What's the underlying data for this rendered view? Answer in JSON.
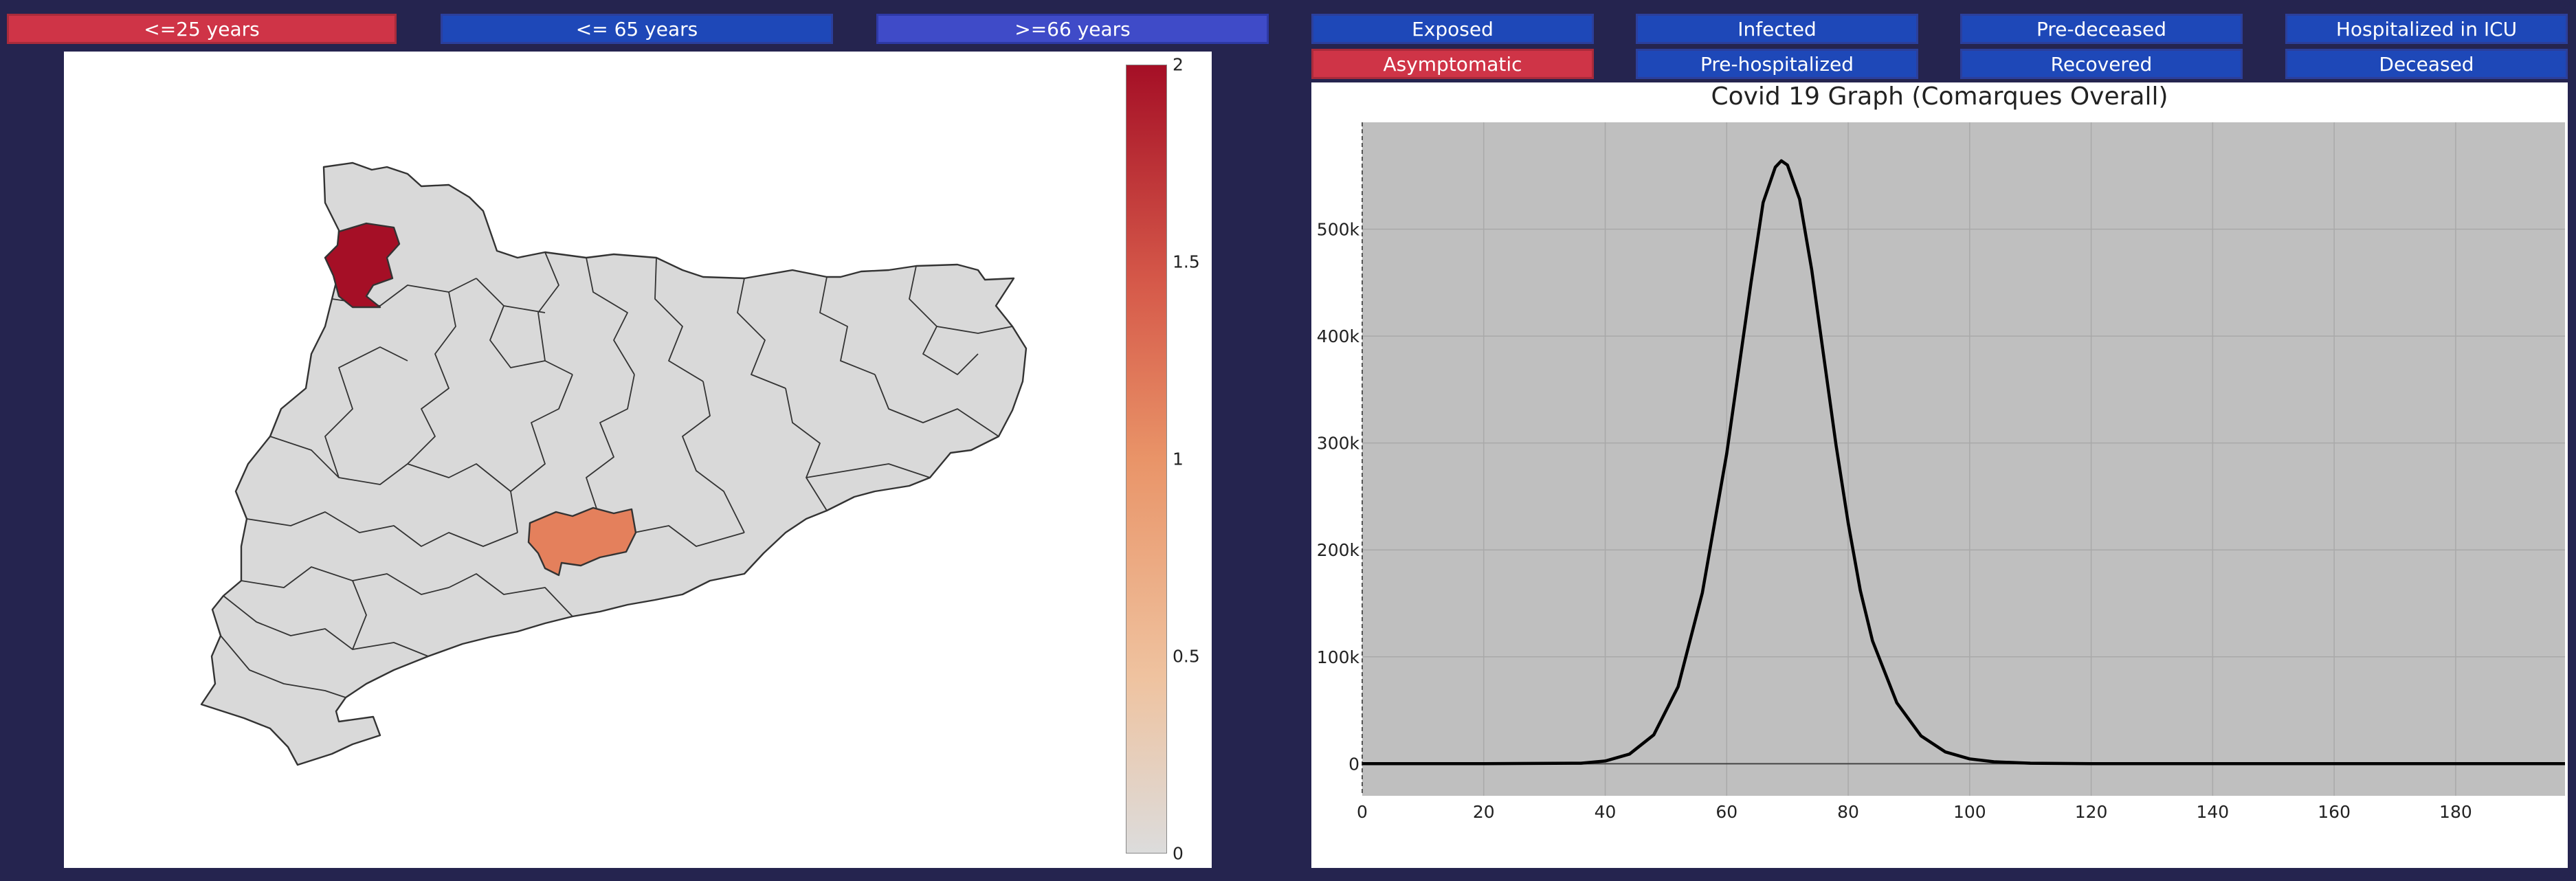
{
  "age_filters": [
    {
      "label": "<=25 years",
      "state": "active"
    },
    {
      "label": "<= 65 years",
      "state": "inactive"
    },
    {
      "label": ">=66 years",
      "state": "alt"
    }
  ],
  "compartment_filters": [
    {
      "label": "Exposed",
      "state": "inactive"
    },
    {
      "label": "Infected",
      "state": "inactive"
    },
    {
      "label": "Pre-deceased",
      "state": "inactive"
    },
    {
      "label": "Hospitalized in ICU",
      "state": "inactive"
    },
    {
      "label": "Asymptomatic",
      "state": "active"
    },
    {
      "label": "Pre-hospitalized",
      "state": "inactive"
    },
    {
      "label": "Recovered",
      "state": "inactive"
    },
    {
      "label": "Deceased",
      "state": "inactive"
    }
  ],
  "colors": {
    "active_button": "#cf3447",
    "inactive_button": "#1e48b8",
    "alt_button": "#3f4bc8",
    "background": "#25244f",
    "region_default": "#d9d9d9",
    "region_high": "#a50f26",
    "region_mid": "#e4805c",
    "plot_bg": "#bfbfbf",
    "line": "#000000"
  },
  "map": {
    "colorbar": {
      "min": 0,
      "max": 2,
      "ticks": [
        "2",
        "1.5",
        "1",
        "0.5",
        "0"
      ]
    },
    "highlighted_regions": [
      {
        "region": "north-west comarca",
        "value": 2
      },
      {
        "region": "south-central comarca",
        "value": 1.1
      }
    ]
  },
  "chart_data": {
    "type": "line",
    "title": "Covid 19 Graph (Comarques Overall)",
    "xlim": [
      0,
      198
    ],
    "ylim": [
      -30000,
      600000
    ],
    "x_ticks": [
      "0",
      "20",
      "40",
      "60",
      "80",
      "100",
      "120",
      "140",
      "160",
      "180"
    ],
    "y_ticks": [
      "0",
      "100k",
      "200k",
      "300k",
      "400k",
      "500k"
    ],
    "grid": true,
    "series": [
      {
        "x": [
          0,
          20,
          36,
          40,
          44,
          48,
          52,
          56,
          60,
          62,
          64,
          66,
          68,
          69,
          70,
          72,
          74,
          76,
          78,
          80,
          82,
          84,
          88,
          92,
          96,
          100,
          104,
          110,
          120,
          140,
          160,
          180,
          198
        ],
        "y": [
          0,
          0,
          500,
          2500,
          9000,
          27000,
          72000,
          160000,
          290000,
          370000,
          450000,
          525000,
          558000,
          564000,
          560000,
          528000,
          462000,
          380000,
          298000,
          225000,
          162000,
          115000,
          57000,
          26000,
          11000,
          4500,
          1800,
          500,
          100,
          0,
          0,
          0,
          0
        ]
      }
    ]
  }
}
